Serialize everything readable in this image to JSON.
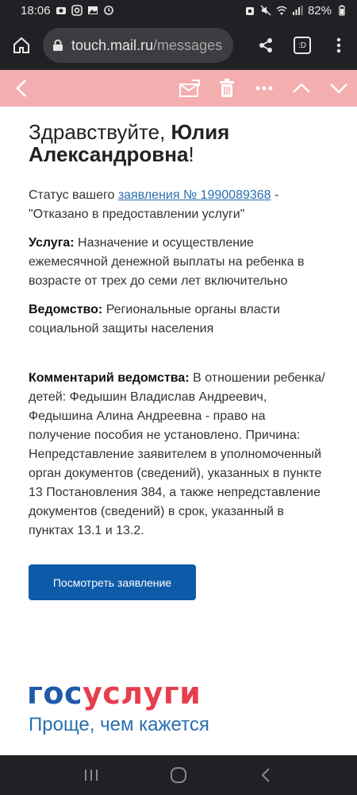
{
  "status_bar": {
    "time": "18:06",
    "battery": "82%",
    "left_icons": [
      "camera-icon",
      "instagram-icon",
      "gallery-icon",
      "sync-icon"
    ],
    "right_icons": [
      "alarm-icon",
      "mute-icon",
      "wifi-icon",
      "signal-icon",
      "battery-icon"
    ]
  },
  "browser": {
    "url_host": "touch.mail.ru",
    "url_path": "/messages",
    "tab_count_label": ":D"
  },
  "mail_toolbar": {
    "icons": [
      "back-icon",
      "mark-read-icon",
      "delete-icon",
      "more-icon",
      "prev-icon",
      "next-icon"
    ]
  },
  "message": {
    "greeting_prefix": "Здравствуйте, ",
    "greeting_name": "Юлия Александровна",
    "greeting_suffix": "!",
    "status_prefix": "Статус вашего ",
    "status_link": "заявления № 1990089368",
    "status_suffix": " - \"Отказано в предоставлении услуги\"",
    "service_label": "Услуга:",
    "service_text": " Назначение и осуществление ежемесячной денежной выплаты на ребенка в возрасте от трех до семи лет включительно",
    "agency_label": "Ведомство:",
    "agency_text": " Региональные органы власти социальной защиты населения",
    "comment_label": "Комментарий ведомства:",
    "comment_text": " В отношении ребенка/детей: Федышин Владислав Андреевич, Федышина Алина Андреевна - право на получение пособия не установлено. Причина: Непредставление заявителем в уполномоченный орган документов (сведений), указанных в пункте 13 Постановления 384, а также непредставление документов (сведений) в срок, указанный в пунктах 13.1 и 13.2.",
    "button_label": "Посмотреть заявление"
  },
  "footer": {
    "logo_part1": "гос",
    "logo_part2": "услуги",
    "tagline": "Проще, чем кажется"
  },
  "colors": {
    "toolbar_bg": "#f5aeb0",
    "button_bg": "#0d5aa8",
    "logo_blue": "#1f5aa8",
    "logo_red": "#e63e4d",
    "link": "#2a6fb0"
  }
}
